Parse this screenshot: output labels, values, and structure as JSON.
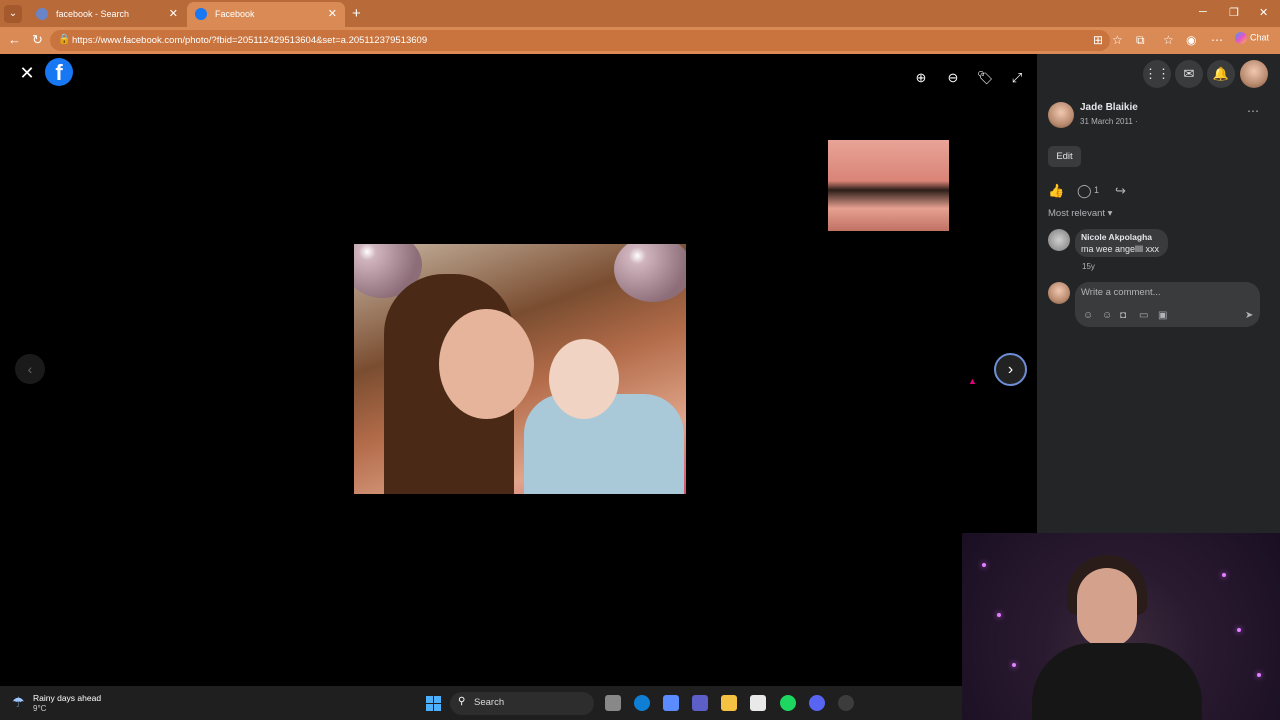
{
  "browser": {
    "tabs": [
      {
        "label": "facebook - Search"
      },
      {
        "label": "Facebook"
      }
    ],
    "url": "https://www.facebook.com/photo/?fbid=205112429513604&set=a.205112379513609",
    "chat_label": "Chat"
  },
  "panel": {
    "author": "Jade Blaikie",
    "date": "31 March 2011 ·",
    "edit_label": "Edit",
    "comment_count": "1",
    "sort_label": "Most relevant",
    "comment": {
      "name": "Nicole Akpolagha",
      "text": "ma wee angellll xxx",
      "age": "15y"
    },
    "write_placeholder": "Write a comment..."
  },
  "taskbar": {
    "weather_title": "Rainy days ahead",
    "weather_temp": "9°C",
    "search_label": "Search"
  },
  "icons": [
    "close-icon",
    "facebook-logo",
    "zoom-in-icon",
    "zoom-out-icon",
    "tag-icon",
    "fullscreen-icon",
    "grid-menu-icon",
    "messenger-icon",
    "bell-icon",
    "like-icon",
    "comment-icon",
    "share-icon",
    "chevron-left-icon",
    "chevron-right-icon"
  ]
}
